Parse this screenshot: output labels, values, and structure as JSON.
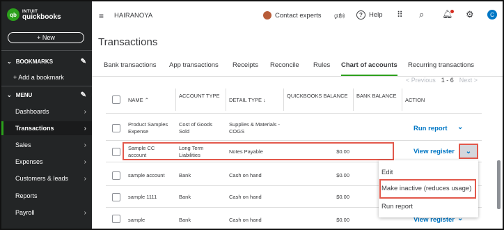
{
  "brand": {
    "mark": "qb",
    "intuit": "INTUIT",
    "name": "quickbooks"
  },
  "sidebar": {
    "new_label": "+ New",
    "bookmarks_label": "BOOKMARKS",
    "add_bookmark": "+ Add a bookmark",
    "menu_label": "MENU",
    "items": [
      {
        "label": "Dashboards"
      },
      {
        "label": "Transactions"
      },
      {
        "label": "Sales"
      },
      {
        "label": "Expenses"
      },
      {
        "label": "Customers & leads"
      },
      {
        "label": "Reports"
      },
      {
        "label": "Payroll"
      }
    ]
  },
  "topbar": {
    "menu_icon": "≡",
    "company": "HAIRANOYA",
    "contact": "Contact experts",
    "help": "Help",
    "user_initial": "C"
  },
  "page": {
    "title": "Transactions"
  },
  "tabs": [
    {
      "label": "Bank transactions"
    },
    {
      "label": "App transactions"
    },
    {
      "label": "Receipts"
    },
    {
      "label": "Reconcile"
    },
    {
      "label": "Rules"
    },
    {
      "label": "Chart of accounts"
    },
    {
      "label": "Recurring transactions"
    }
  ],
  "pager": {
    "prev": "< Previous",
    "count": "1 - 6",
    "next": "Next >"
  },
  "table": {
    "headers": {
      "name": "NAME ⌃",
      "account_type": "ACCOUNT TYPE",
      "detail_type": "DETAIL TYPE ↓",
      "qb_balance": "QUICKBOOKS BALANCE",
      "bank_balance": "BANK BALANCE",
      "action": "ACTION"
    },
    "rows": [
      {
        "name": "Product Samples Expense",
        "account_type": "Cost of Goods Sold",
        "detail_type": "Supplies & Materials - COGS",
        "qb_balance": "",
        "action": "Run report"
      },
      {
        "name": "Sample CC account",
        "account_type": "Long Term Liabilities",
        "detail_type": "Notes Payable",
        "qb_balance": "$0.00",
        "action": "View register"
      },
      {
        "name": "sample account",
        "account_type": "Bank",
        "detail_type": "Cash on hand",
        "qb_balance": "$0.00",
        "action": ""
      },
      {
        "name": "sample 1111",
        "account_type": "Bank",
        "detail_type": "Cash on hand",
        "qb_balance": "$0.00",
        "action": ""
      },
      {
        "name": "sample",
        "account_type": "Bank",
        "detail_type": "Cash on hand",
        "qb_balance": "$0.00",
        "action": "View register"
      }
    ]
  },
  "dropdown_menu": {
    "items": [
      {
        "label": "Edit"
      },
      {
        "label": "Make inactive (reduces usage)"
      },
      {
        "label": "Run report"
      }
    ]
  },
  "colors": {
    "accent_green": "#2ca01c",
    "link_blue": "#0077c5",
    "highlight_red": "#e2584b",
    "sidebar_bg": "#232526"
  }
}
